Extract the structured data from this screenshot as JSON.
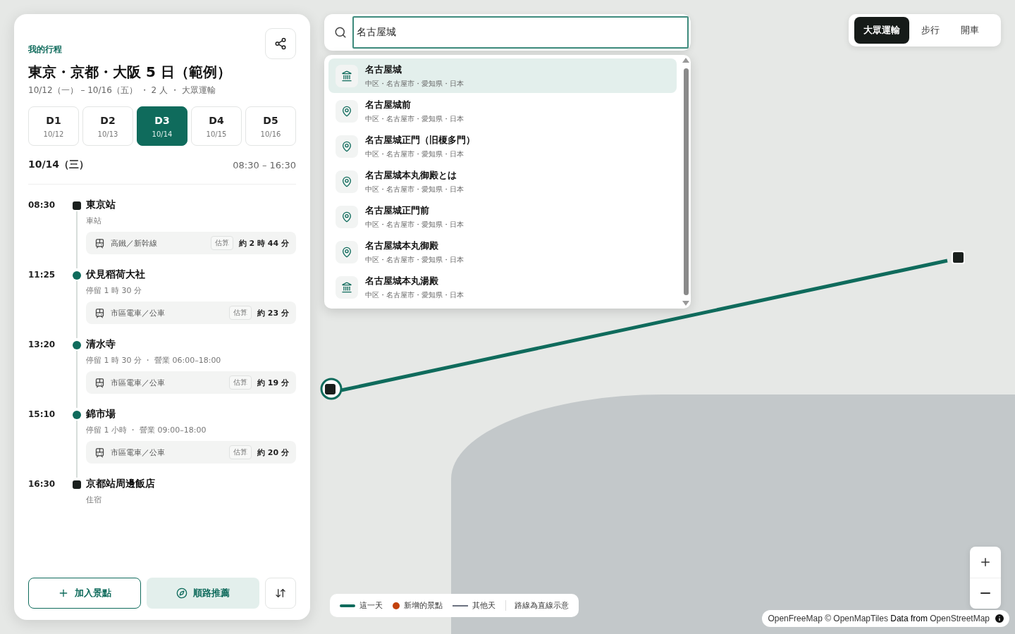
{
  "itinerary": {
    "label": "我的行程",
    "title": "東京・京都・大阪 5 日（範例）",
    "subtitle": "10/12（一） – 10/16（五） ・ 2 人 ・ 大眾運輸",
    "days": [
      {
        "label": "D1",
        "date": "10/12",
        "selected": false
      },
      {
        "label": "D2",
        "date": "10/13",
        "selected": false
      },
      {
        "label": "D3",
        "date": "10/14",
        "selected": true
      },
      {
        "label": "D4",
        "date": "10/15",
        "selected": false
      },
      {
        "label": "D5",
        "date": "10/16",
        "selected": false
      }
    ],
    "day_date": "10/14（三）",
    "day_hours": "08:30 – 16:30",
    "stops": [
      {
        "time": "08:30",
        "kind": "endpoint",
        "name": "東京站",
        "detail": "車站",
        "transit": {
          "mode": "高鐵／新幹線",
          "badge": "估算",
          "duration": "約 2 時 44 分"
        }
      },
      {
        "time": "11:25",
        "kind": "stop",
        "name": "伏見稻荷大社",
        "detail": "停留 1 時 30 分",
        "transit": {
          "mode": "市區電車／公車",
          "badge": "估算",
          "duration": "約 23 分"
        }
      },
      {
        "time": "13:20",
        "kind": "stop",
        "name": "清水寺",
        "detail": "停留 1 時 30 分 ・ 營業 06:00–18:00",
        "transit": {
          "mode": "市區電車／公車",
          "badge": "估算",
          "duration": "約 19 分"
        }
      },
      {
        "time": "15:10",
        "kind": "stop",
        "name": "錦市場",
        "detail": "停留 1 小時 ・ 營業 09:00–18:00",
        "transit": {
          "mode": "市區電車／公車",
          "badge": "估算",
          "duration": "約 20 分"
        }
      },
      {
        "time": "16:30",
        "kind": "endpoint",
        "name": "京都站周邊飯店",
        "detail": "住宿"
      }
    ],
    "add_button": "加入景點",
    "optimize_button": "順路推薦"
  },
  "search": {
    "value": "名古屋城"
  },
  "suggestions": [
    {
      "kind": "landmark",
      "name": "名古屋城",
      "address": "中区・名古屋市・愛知県・日本",
      "selected": true
    },
    {
      "kind": "place",
      "name": "名古屋城前",
      "address": "中区・名古屋市・愛知県・日本",
      "selected": false
    },
    {
      "kind": "place",
      "name": "名古屋城正門（旧榎多門）",
      "address": "中区・名古屋市・愛知県・日本",
      "selected": false
    },
    {
      "kind": "place",
      "name": "名古屋城本丸御殿とは",
      "address": "中区・名古屋市・愛知県・日本",
      "selected": false
    },
    {
      "kind": "place",
      "name": "名古屋城正門前",
      "address": "中区・名古屋市・愛知県・日本",
      "selected": false
    },
    {
      "kind": "place",
      "name": "名古屋城本丸御殿",
      "address": "中区・名古屋市・愛知県・日本",
      "selected": false
    },
    {
      "kind": "landmark",
      "name": "名古屋城本丸湯殿",
      "address": "中区・名古屋市・愛知県・日本",
      "selected": false
    }
  ],
  "modes": [
    {
      "label": "大眾運輸",
      "selected": true
    },
    {
      "label": "步行",
      "selected": false
    },
    {
      "label": "開車",
      "selected": false
    }
  ],
  "legend": [
    {
      "kind": "line",
      "label": "這一天",
      "color": "#0f6b5c"
    },
    {
      "kind": "dot",
      "label": "新增的景點",
      "color": "#c2410c"
    },
    {
      "kind": "thin",
      "label": "其他天",
      "color": "#6b7280"
    },
    {
      "kind": "note",
      "label": "路線為直線示意"
    }
  ],
  "attribution": "OpenFreeMap © OpenMapTiles **Data from** OpenStreetMap"
}
